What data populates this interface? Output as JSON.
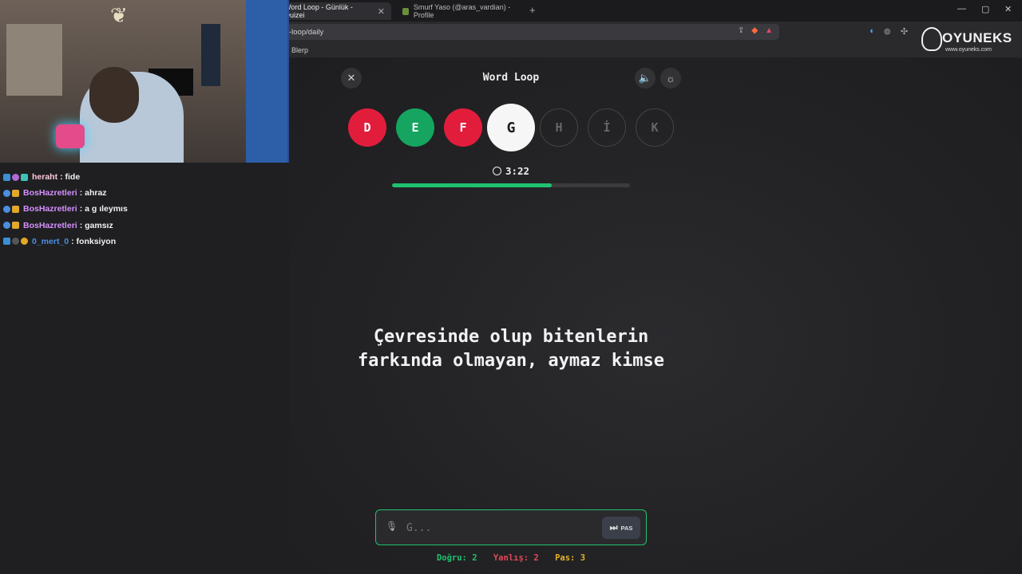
{
  "browser": {
    "tabs": [
      {
        "title": "Word Loop - Günlük - Quizei",
        "active": true
      },
      {
        "title": "Smurf Yaso (@aras_vardian) - Profile",
        "active": false
      }
    ],
    "url": "-loop/daily",
    "bookmark": "Blerp"
  },
  "chat": [
    {
      "user": "heraht",
      "msg": ": fide",
      "color": "#ffc8e0"
    },
    {
      "user": "BosHazretleri",
      "msg": ": ahraz",
      "color": "#d790ff"
    },
    {
      "user": "BosHazretleri",
      "msg": ": a g ıleymıs",
      "color": "#d790ff"
    },
    {
      "user": "BosHazretleri",
      "msg": ": gamsız",
      "color": "#d790ff"
    },
    {
      "user": "0_mert_0",
      "msg": ": fonksiyon",
      "color": "#4a90e2"
    }
  ],
  "logo": {
    "name": "OYUNEKS",
    "site": "www.oyuneks.com"
  },
  "game": {
    "title": "Word Loop",
    "letters": [
      {
        "char": "D",
        "state": "wrong"
      },
      {
        "char": "E",
        "state": "correct"
      },
      {
        "char": "F",
        "state": "wrong"
      },
      {
        "char": "G",
        "state": "current"
      },
      {
        "char": "H",
        "state": "pending"
      },
      {
        "char": "İ",
        "state": "pending"
      },
      {
        "char": "K",
        "state": "pending"
      }
    ],
    "timer": "3:22",
    "time_progress": 0.67,
    "clue_line1": "Çevresinde olup bitenlerin",
    "clue_line2": "farkında olmayan, aymaz kimse",
    "input_placeholder": "G...",
    "pass_label": "PAS",
    "score": {
      "correct": "Doğru: 2",
      "wrong": "Yanlış: 2",
      "pass": "Pas: 3"
    },
    "colors": {
      "correct": "#15a560",
      "wrong": "#e21d3c",
      "accent": "#1fc16f"
    }
  }
}
